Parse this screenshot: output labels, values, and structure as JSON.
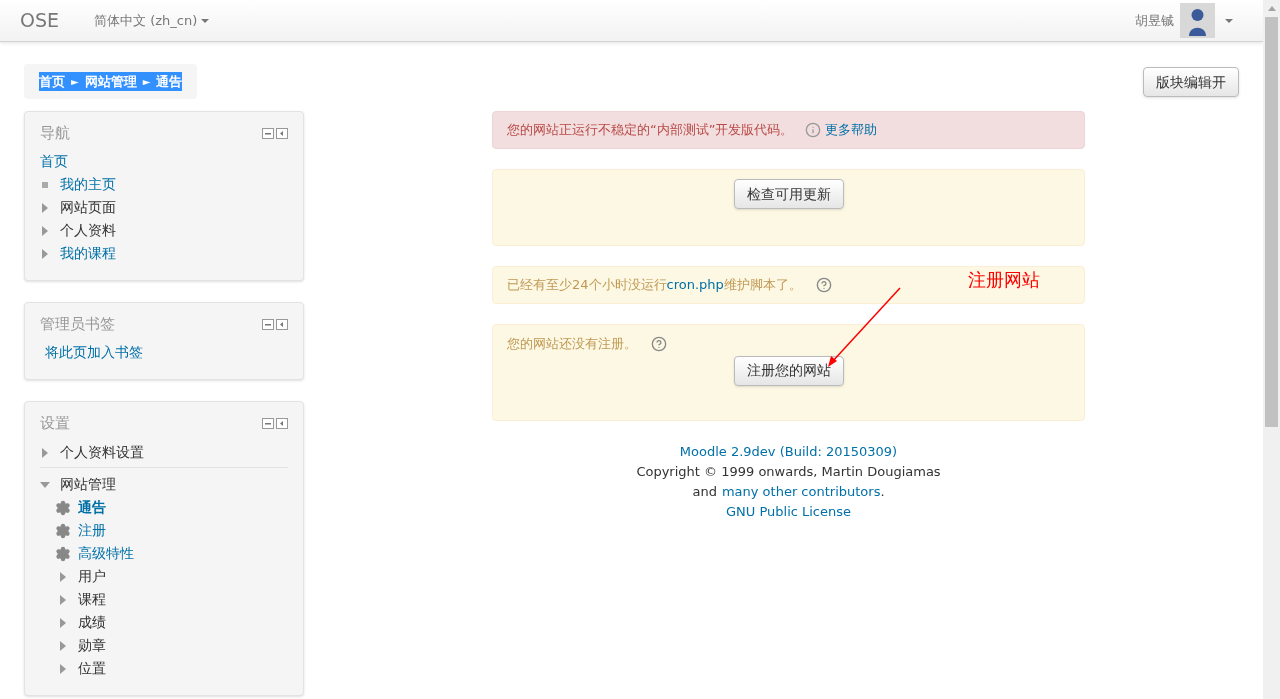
{
  "navbar": {
    "brand": "OSE",
    "language": "简体中文 (zh_cn)",
    "user": "胡昱铖"
  },
  "breadcrumb": {
    "highlighted": true,
    "items": [
      {
        "label": "首页",
        "separator": "►"
      },
      {
        "label": "网站管理",
        "separator": "►"
      },
      {
        "label": "通告"
      }
    ]
  },
  "edit_button": "版块编辑开",
  "blocks": [
    {
      "title": "导航",
      "items": [
        {
          "label": "首页",
          "kind": "plain",
          "link": true,
          "children": [
            {
              "label": "我的主页",
              "kind": "leaf",
              "link": true
            },
            {
              "label": "网站页面",
              "kind": "collapsed",
              "link": false
            },
            {
              "label": "个人资料",
              "kind": "collapsed",
              "link": false
            },
            {
              "label": "我的课程",
              "kind": "collapsed",
              "link": true
            }
          ]
        }
      ]
    },
    {
      "title": "管理员书签",
      "items": [
        {
          "label": "将此页加入书签",
          "kind": "plain",
          "link": true
        }
      ]
    },
    {
      "title": "设置",
      "items": [
        {
          "label": "个人资料设置",
          "kind": "collapsed",
          "link": false,
          "divider": true
        },
        {
          "label": "网站管理",
          "kind": "expanded",
          "link": false,
          "children": [
            {
              "label": "通告",
              "kind": "setting",
              "link": true,
              "current": true
            },
            {
              "label": "注册",
              "kind": "setting",
              "link": true,
              "current": false
            },
            {
              "label": "高级特性",
              "kind": "setting",
              "link": true,
              "current": false
            },
            {
              "label": "用户",
              "kind": "collapsed",
              "link": false
            },
            {
              "label": "课程",
              "kind": "collapsed",
              "link": false
            },
            {
              "label": "成绩",
              "kind": "collapsed",
              "link": false
            },
            {
              "label": "勋章",
              "kind": "collapsed",
              "link": false
            },
            {
              "label": "位置",
              "kind": "collapsed",
              "link": false
            }
          ]
        }
      ]
    }
  ],
  "alerts": [
    {
      "kind": "error",
      "text": "您的网站正运行不稳定的“内部测试”开发版代码。",
      "help_link": "更多帮助"
    },
    {
      "kind": "button",
      "button": "检查可用更新"
    },
    {
      "kind": "notice",
      "text_before": "已经有至少24个小时没运行",
      "link": "cron.php",
      "text_after": "维护脚本了。"
    },
    {
      "kind": "register",
      "text": "您的网站还没有注册。",
      "button": "注册您的网站"
    }
  ],
  "annotation": "注册网站",
  "footer": {
    "version": "Moodle 2.9dev (Build: 20150309)",
    "copyright": "Copyright © 1999 onwards, Martin Dougiamas",
    "and": "and",
    "contributors": "many other contributors",
    "period": ".",
    "license": "GNU Public License"
  }
}
